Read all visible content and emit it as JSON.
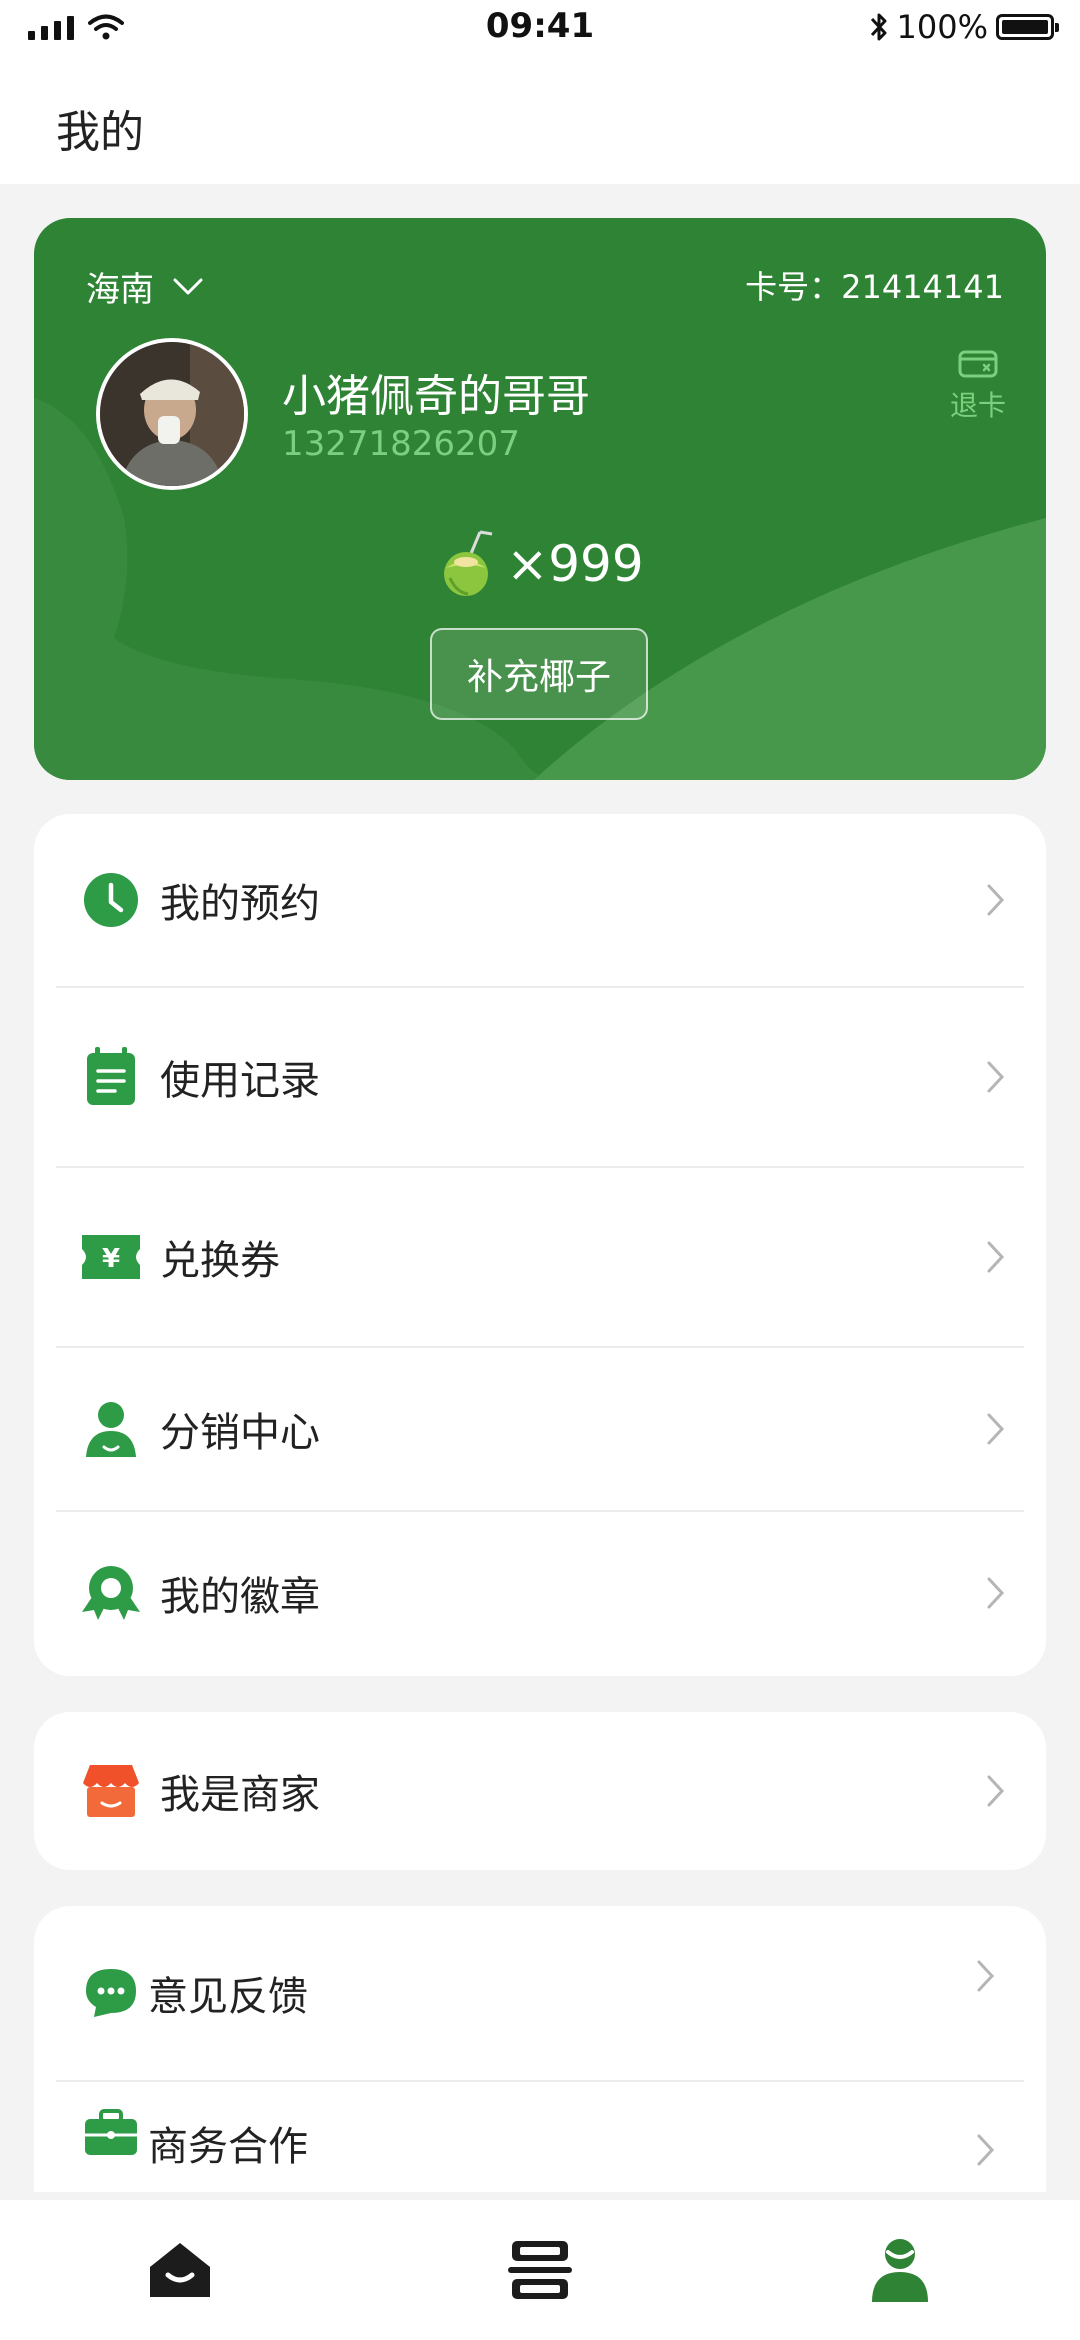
{
  "status": {
    "time": "09:41",
    "battery": "100%"
  },
  "header": {
    "title": "我的"
  },
  "card": {
    "region": "海南",
    "card_no": "卡号：21414141",
    "username": "小猪佩奇的哥哥",
    "phone": "13271826207",
    "refund_label": "退卡",
    "coin_count": "×999",
    "recharge_label": "补充椰子"
  },
  "menu": {
    "appointments": "我的预约",
    "usage": "使用记录",
    "coupons": "兑换券",
    "distribution": "分销中心",
    "badges": "我的徽章",
    "merchant": "我是商家",
    "feedback": "意见反馈",
    "business": "商务合作"
  },
  "colors": {
    "brand": "#2f8335",
    "accent_light": "#7bd07f",
    "icon_green": "#2e9b47",
    "merchant": "#f0502a"
  },
  "tabs": [
    "home-icon",
    "scan-icon",
    "profile-icon"
  ]
}
